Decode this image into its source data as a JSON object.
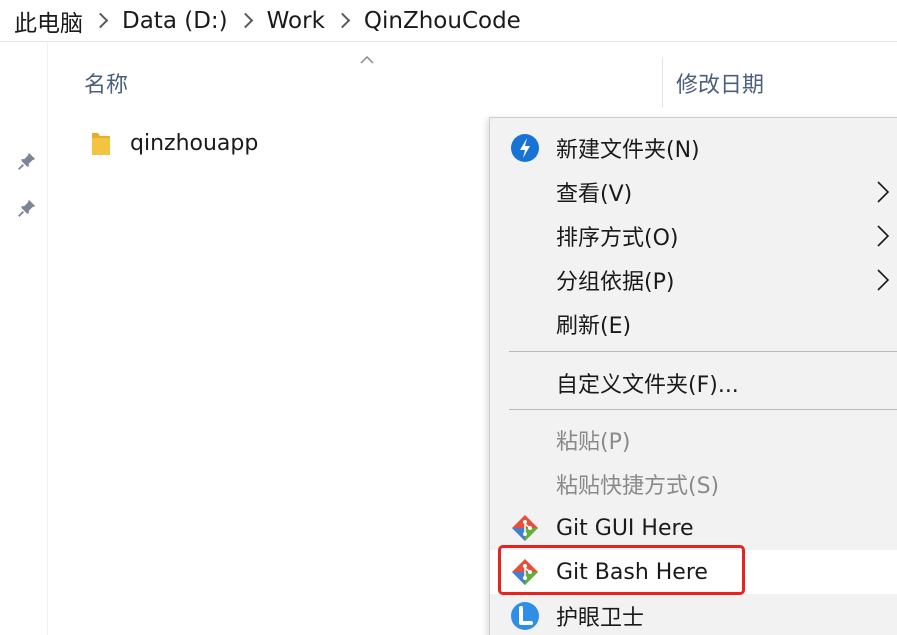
{
  "breadcrumb": {
    "items": [
      "此电脑",
      "Data (D:)",
      "Work",
      "QinZhouCode"
    ]
  },
  "icons": {
    "breadcrumb_separator": "chevron-right-icon",
    "quick_access_pin": "pin-icon",
    "folder": "folder-icon",
    "new_folder": "new-folder-icon",
    "git": "git-icon",
    "eye_care": "eye-care-icon",
    "submenu": "chevron-right-icon",
    "sort": "sort-ascending-icon"
  },
  "columns": {
    "name": "名称",
    "date_modified": "修改日期"
  },
  "files": [
    {
      "name": "qinzhouapp"
    }
  ],
  "context_menu": {
    "items": [
      {
        "label": "新建文件夹(N)",
        "icon": "new-folder-icon",
        "submenu": false,
        "disabled": false
      },
      {
        "label": "查看(V)",
        "icon": "",
        "submenu": true,
        "disabled": false
      },
      {
        "label": "排序方式(O)",
        "icon": "",
        "submenu": true,
        "disabled": false
      },
      {
        "label": "分组依据(P)",
        "icon": "",
        "submenu": true,
        "disabled": false
      },
      {
        "label": "刷新(E)",
        "icon": "",
        "submenu": false,
        "disabled": false
      },
      {
        "label": "自定义文件夹(F)...",
        "icon": "",
        "submenu": false,
        "disabled": false
      },
      {
        "label": "粘贴(P)",
        "icon": "",
        "submenu": false,
        "disabled": true
      },
      {
        "label": "粘贴快捷方式(S)",
        "icon": "",
        "submenu": false,
        "disabled": true
      },
      {
        "label": "Git GUI Here",
        "icon": "git-icon",
        "submenu": false,
        "disabled": false
      },
      {
        "label": "Git Bash Here",
        "icon": "git-icon",
        "submenu": false,
        "disabled": false,
        "highlighted": true
      },
      {
        "label": "护眼卫士",
        "icon": "eye-care-icon",
        "submenu": false,
        "disabled": false
      }
    ]
  },
  "colors": {
    "menu_background": "#f2f2f2",
    "highlight_background": "#ffffff",
    "annotation_red": "#e8231d",
    "folder_yellow": "#f5c342",
    "disabled_text": "#8a8a8a",
    "header_text": "#4c607a",
    "new_folder_blue": "#1773d6",
    "git_red": "#e4503a",
    "git_green": "#5fb13c",
    "git_blue": "#3f82d4"
  }
}
